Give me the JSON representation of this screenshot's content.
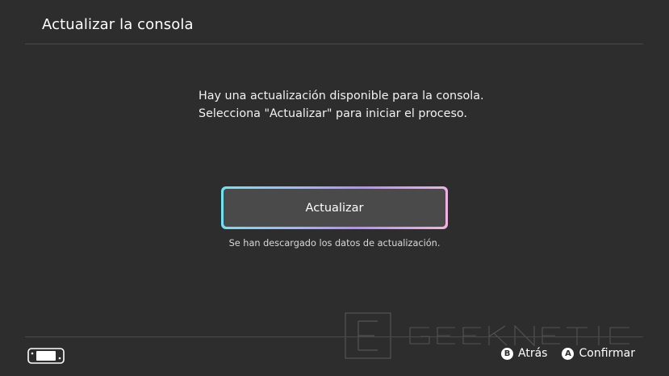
{
  "header": {
    "title": "Actualizar la consola"
  },
  "message": {
    "line1": "Hay una actualización disponible para la consola.",
    "line2": "Selecciona \"Actualizar\" para iniciar el proceso."
  },
  "update_button": {
    "label": "Actualizar"
  },
  "update_note": "Se han descargado los datos de actualización.",
  "watermark": {
    "text": "GEEKNETIC",
    "mark": "E"
  },
  "footer": {
    "icon": "handheld-console-icon",
    "back": {
      "glyph": "B",
      "label": "Atrás"
    },
    "confirm": {
      "glyph": "A",
      "label": "Confirmar"
    }
  },
  "colors": {
    "background": "#2d2d2d",
    "button_fill": "#4a4a4a",
    "focus_gradient": [
      "#6fe4f0",
      "#9fb6ff",
      "#b48cff",
      "#f3b4e2"
    ]
  }
}
